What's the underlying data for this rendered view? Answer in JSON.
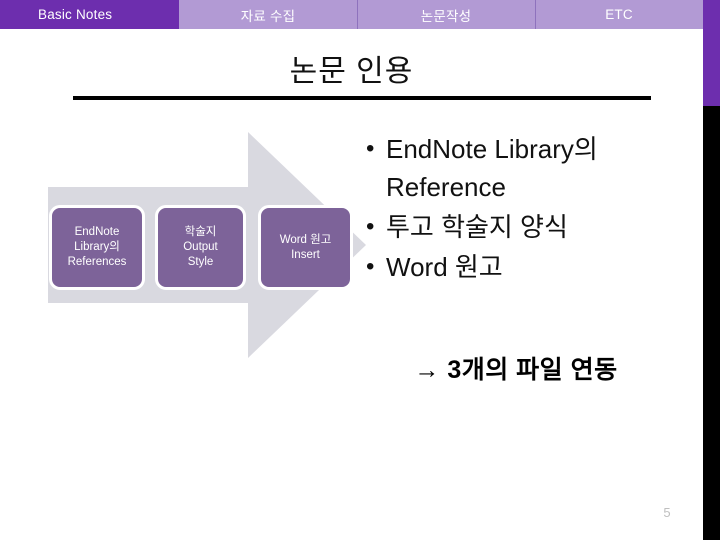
{
  "navbar": {
    "tabs": [
      {
        "label": "Basic Notes",
        "active": true
      },
      {
        "label": "자료 수집",
        "active": false
      },
      {
        "label": "논문작성",
        "active": false
      },
      {
        "label": "ETC",
        "active": false
      }
    ]
  },
  "slide": {
    "title": "논문 인용",
    "page_number": "5"
  },
  "process": {
    "boxes": [
      {
        "text": "EndNote\nLibrary의\nReferences"
      },
      {
        "text": "학술지\nOutput\nStyle"
      },
      {
        "text": "Word 원고\nInsert"
      }
    ]
  },
  "bullets": [
    {
      "marker": "•",
      "text": "EndNote Library의 Reference"
    },
    {
      "marker": "•",
      "text": "투고 학술지 양식"
    },
    {
      "marker": "•",
      "text": "Word 원고"
    }
  ],
  "conclusion": {
    "text": "→ 3개의 파일 연동"
  },
  "colors": {
    "nav_active": "#6d2eae",
    "nav_inactive": "#b29ad4",
    "box_fill": "#7d6399",
    "arrow_fill": "#d9d9e0",
    "edge_bar_purple": "#6d2eae",
    "edge_bar_dark": "#000000",
    "page_number": "#bfbfbf"
  }
}
